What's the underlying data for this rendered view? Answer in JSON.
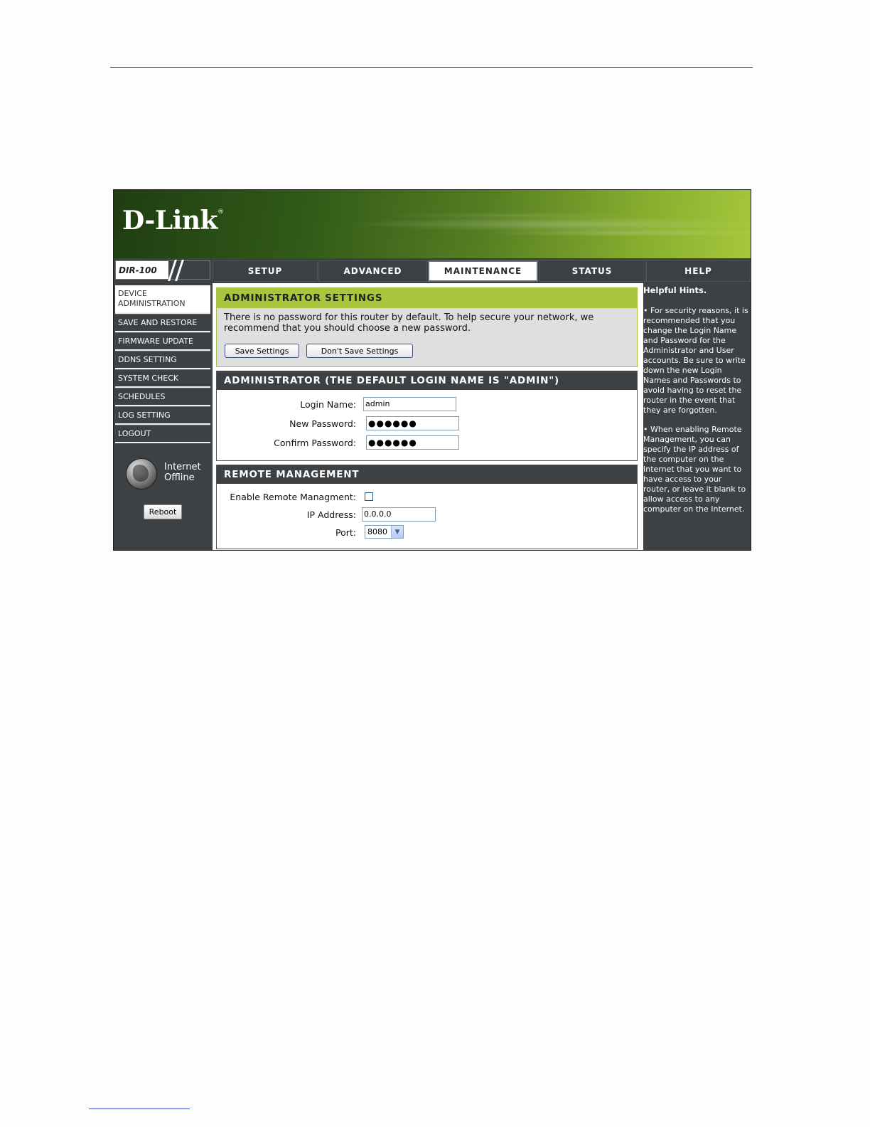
{
  "brand": {
    "logo_text": "D-Link",
    "registered_mark": "®"
  },
  "model": {
    "label": "DIR-100"
  },
  "tabs": [
    {
      "label": "SETUP",
      "active": false
    },
    {
      "label": "ADVANCED",
      "active": false
    },
    {
      "label": "MAINTENANCE",
      "active": true
    },
    {
      "label": "STATUS",
      "active": false
    },
    {
      "label": "HELP",
      "active": false
    }
  ],
  "sidebar": {
    "items": [
      {
        "label": "DEVICE ADMINISTRATION",
        "active": true
      },
      {
        "label": "SAVE AND RESTORE",
        "active": false
      },
      {
        "label": "FIRMWARE UPDATE",
        "active": false
      },
      {
        "label": "DDNS SETTING",
        "active": false
      },
      {
        "label": "SYSTEM CHECK",
        "active": false
      },
      {
        "label": "SCHEDULES",
        "active": false
      },
      {
        "label": "LOG SETTING",
        "active": false
      },
      {
        "label": "LOGOUT",
        "active": false
      }
    ],
    "status_line1": "Internet",
    "status_line2": "Offline",
    "globe_icon": "globe-icon",
    "reboot_label": "Reboot"
  },
  "admin_settings": {
    "title": "ADMINISTRATOR SETTINGS",
    "intro": "There is no password for this router by default. To help secure your network, we recommend that you should choose a new password.",
    "save_label": "Save Settings",
    "dont_save_label": "Don't Save Settings"
  },
  "administrator": {
    "title": "ADMINISTRATOR (THE DEFAULT LOGIN NAME IS \"ADMIN\")",
    "login_label": "Login Name:",
    "login_value": "admin",
    "new_password_label": "New Password:",
    "new_password_value": "●●●●●●",
    "confirm_password_label": "Confirm Password:",
    "confirm_password_value": "●●●●●●"
  },
  "remote": {
    "title": "REMOTE MANAGEMENT",
    "enable_label": "Enable Remote Managment:",
    "enable_checked": false,
    "ip_label": "IP Address:",
    "ip_value": "0.0.0.0",
    "port_label": "Port:",
    "port_value": "8080"
  },
  "help": {
    "title": "Helpful Hints.",
    "hint1": "• For security reasons, it is recommended that you change the Login Name and Password for the Administrator and User accounts. Be sure to write down the new Login Names and Passwords to avoid having to reset the router in the event that they are forgotten.",
    "hint2": "• When enabling Remote Management, you can specify the IP address of the computer on the Internet that you want to have access to your router, or leave it blank to allow access to any computer on the Internet."
  },
  "colors": {
    "accent_green": "#a9c53e",
    "dark_gray": "#3d4144"
  }
}
